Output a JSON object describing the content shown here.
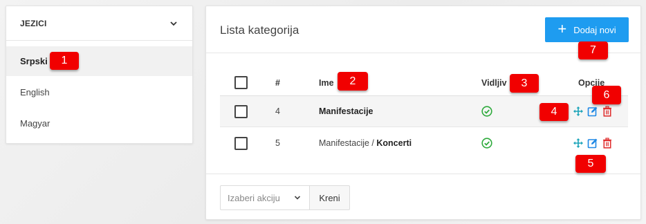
{
  "sidebar": {
    "title": "JEZICI",
    "items": [
      {
        "label": "Srpski",
        "active": true
      },
      {
        "label": "English",
        "active": false
      },
      {
        "label": "Magyar",
        "active": false
      }
    ]
  },
  "panel": {
    "title": "Lista kategorija",
    "add_button": "Dodaj novi",
    "columns": {
      "num": "#",
      "name": "Ime",
      "visible": "Vidljiv",
      "options": "Opcije"
    },
    "rows": [
      {
        "num": "4",
        "name_prefix": "",
        "name_bold": "Manifestacije",
        "visible": true
      },
      {
        "num": "5",
        "name_prefix": "Manifestacije / ",
        "name_bold": "Koncerti",
        "visible": true
      }
    ],
    "footer": {
      "select_placeholder": "Izaberi akciju",
      "go_button": "Kreni"
    }
  },
  "markers": [
    "1",
    "2",
    "3",
    "4",
    "5",
    "6",
    "7"
  ],
  "colors": {
    "primary": "#1e9cf0",
    "success": "#2eaa3c",
    "move": "#1aa3b8",
    "edit": "#1e88e5",
    "delete": "#e03030",
    "marker": "#f10000"
  },
  "icons": [
    "chevron-down-icon",
    "plus-icon",
    "check-circle-icon",
    "move-icon",
    "edit-icon",
    "trash-icon",
    "caret-down-icon"
  ]
}
